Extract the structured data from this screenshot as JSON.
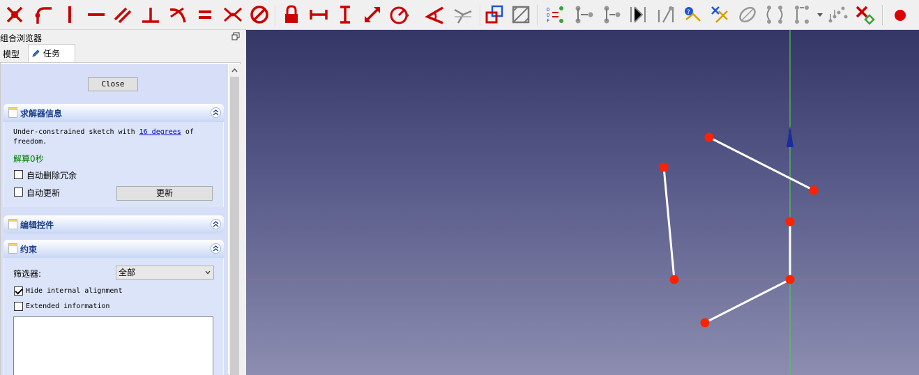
{
  "toolbar": {
    "tools": [
      {
        "name": "sketcher-point-icon"
      },
      {
        "name": "sketcher-fillet-icon"
      },
      {
        "name": "constrain-vertical-icon"
      },
      {
        "name": "constrain-horizontal-icon"
      },
      {
        "name": "constrain-parallel-icon"
      },
      {
        "name": "constrain-perpendicular-icon"
      },
      {
        "name": "constrain-tangent-icon"
      },
      {
        "name": "constrain-equal-icon"
      },
      {
        "name": "constrain-symmetric-icon"
      },
      {
        "name": "constrain-block-icon"
      },
      {
        "name": "constrain-lock-icon"
      },
      {
        "name": "constrain-horizontal-distance-icon"
      },
      {
        "name": "constrain-vertical-distance-icon"
      },
      {
        "name": "constrain-distance-icon"
      },
      {
        "name": "constrain-radius-icon"
      },
      {
        "name": "constrain-angle-icon"
      },
      {
        "name": "constrain-snell-icon"
      },
      {
        "name": "toggle-construction-icon"
      },
      {
        "name": "toggle-driving-icon"
      }
    ],
    "dof_label": "DOF"
  },
  "panel": {
    "title": "组合浏览器",
    "tabs": {
      "model": "模型",
      "task": "任务"
    },
    "close_label": "Close",
    "solver": {
      "title": "求解器信息",
      "message_prefix": "Under-constrained sketch with ",
      "dof_link": "16 degrees",
      "message_suffix": " of freedom.",
      "time": "解算0秒",
      "auto_remove_redundant": "自动删除冗余",
      "auto_update": "自动更新",
      "update_button": "更新"
    },
    "edit_controls": {
      "title": "编辑控件"
    },
    "constraints": {
      "title": "约束",
      "filter_label": "筛选器:",
      "filter_value": "全部",
      "hide_internal": "Hide internal alignment",
      "extended_info": "Extended information"
    }
  },
  "colors": {
    "point": "#ff2200",
    "line": "#ffffff",
    "x_axis": "#e05050",
    "y_axis": "#4ccc4c",
    "toolbar_red": "#cc0000"
  }
}
